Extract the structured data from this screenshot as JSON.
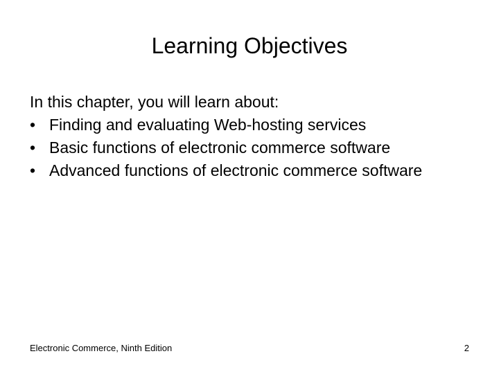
{
  "slide": {
    "title": "Learning Objectives",
    "intro": "In this chapter, you will learn about:",
    "bullets": [
      "Finding and evaluating Web-hosting services",
      "Basic functions of electronic commerce software",
      "Advanced functions of electronic commerce software"
    ],
    "bullet_glyph": "•"
  },
  "footer": {
    "book_title": "Electronic Commerce, Ninth Edition",
    "page_number": "2"
  }
}
